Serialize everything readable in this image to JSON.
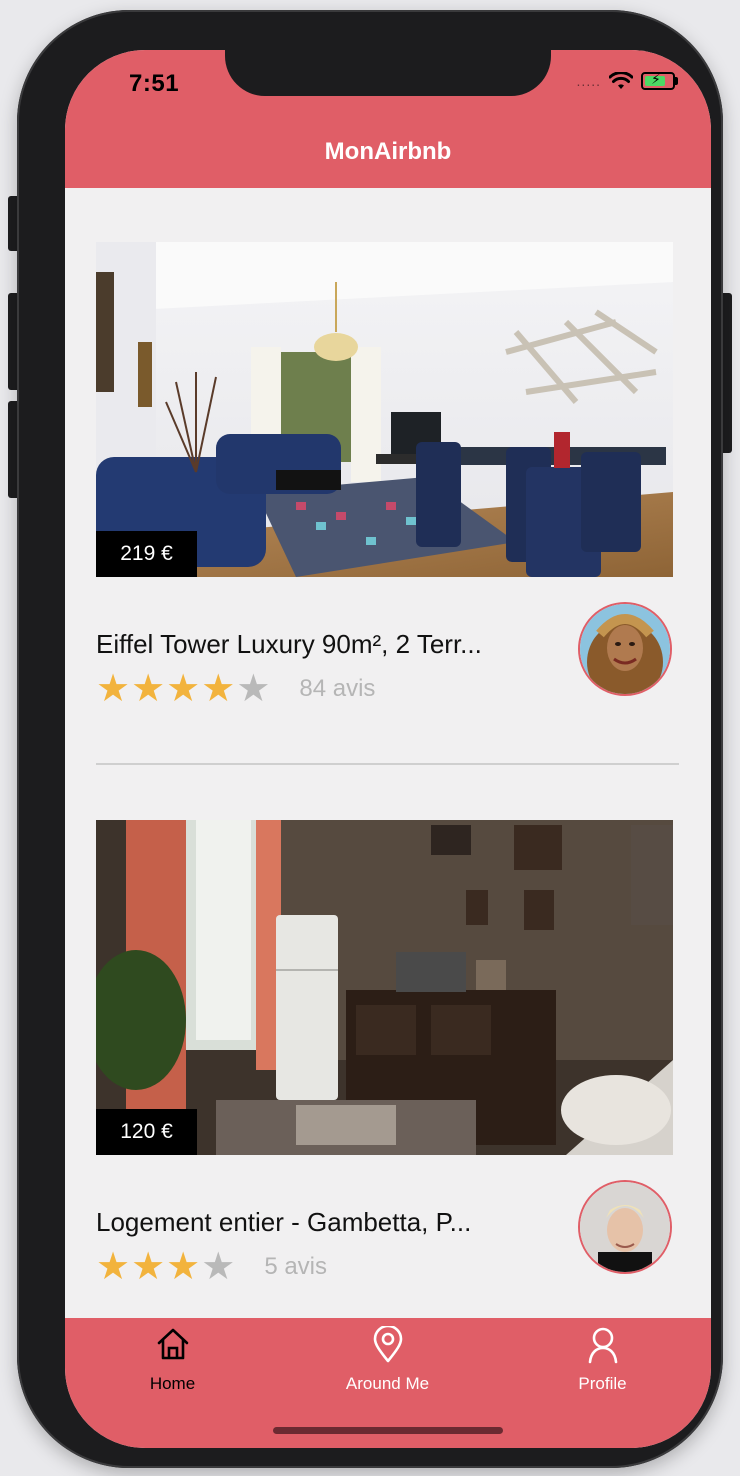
{
  "status_bar": {
    "time": "7:51",
    "signal": "....."
  },
  "header": {
    "title": "MonAirbnb"
  },
  "listings": [
    {
      "price": "219 €",
      "title": "Eiffel Tower Luxury 90m², 2 Terr...",
      "rating": 4,
      "max_rating": 5,
      "reviews": "84 avis"
    },
    {
      "price": "120 €",
      "title": "Logement entier - Gambetta, P...",
      "rating": 3,
      "max_rating": 4,
      "reviews": "5 avis"
    }
  ],
  "tabs": [
    {
      "label": "Home",
      "icon": "home-icon",
      "active": true
    },
    {
      "label": "Around Me",
      "icon": "map-pin-icon",
      "active": false
    },
    {
      "label": "Profile",
      "icon": "user-icon",
      "active": false
    }
  ],
  "colors": {
    "brand": "#e05e67",
    "star": "#f2b33d",
    "star_off": "#b9b9b9",
    "background": "#f1f0f1"
  }
}
